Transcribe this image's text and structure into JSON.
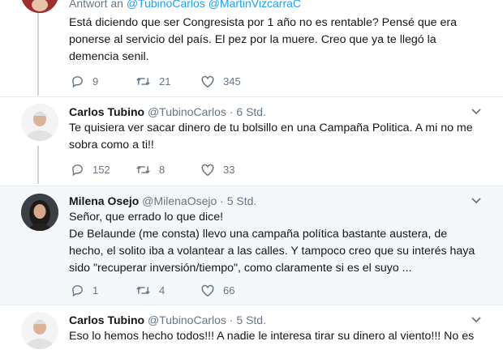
{
  "tweet1": {
    "reply_prefix": "Antwort an",
    "reply_handle1": "@TubinoCarlos",
    "reply_handle2": "@MartinVizcarraC",
    "text": "Está diciendo que ser Congresista por 1 año no es rentable? Pensé que era ponerse al servicio del país. El pez por la muere. Creo que ya te llegó la demencia senil.",
    "replies": "9",
    "retweets": "21",
    "likes": "345"
  },
  "tweet2": {
    "name": "Carlos Tubino",
    "handle": "@TubinoCarlos",
    "dot": "·",
    "time": "6 Std.",
    "text": "Te quisiera ver sacar dinero de tu bolsillo en una Campaña Politica. A mi no me sobra como a ti!!",
    "replies": "152",
    "retweets": "8",
    "likes": "33"
  },
  "tweet3": {
    "name": "Milena Osejo",
    "handle": "@MilenaOsejo",
    "dot": "·",
    "time": "5 Std.",
    "text": "Señor, que errado lo que dice!\nDe Belaunde (me consta) llevo una campaña política bastante austera, de hecho, el solito iba a volantear a las calles. Y tampoco creo que su interés haya sido \"recuperar inversión/tiempo\", como claramente si es el suyo ...",
    "replies": "1",
    "retweets": "4",
    "likes": "66"
  },
  "tweet4": {
    "name": "Carlos Tubino",
    "handle": "@TubinoCarlos",
    "dot": "·",
    "time": "5 Std.",
    "text": "Eso lo hemos hecho todos!!! A nadie le interesa tirar su dinero al viento!!! No es"
  },
  "colors": {
    "accent": "#1da1f2",
    "muted": "#657786",
    "thread_line": "#ccd6dd",
    "highlight_bg": "#f5f8fa"
  },
  "icons": [
    "reply-icon",
    "retweet-icon",
    "like-icon",
    "chevron-down-icon"
  ]
}
